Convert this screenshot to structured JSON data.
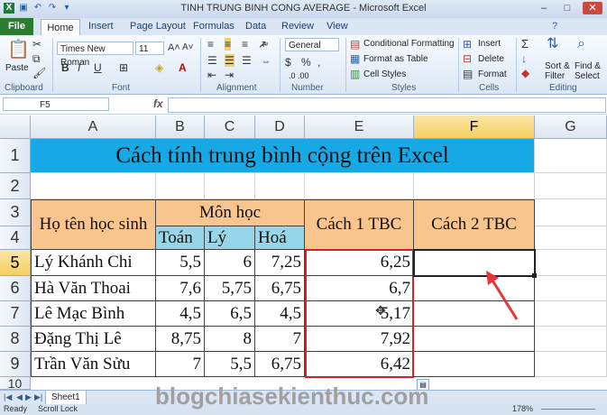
{
  "window": {
    "title": "TINH TRUNG BINH CONG AVERAGE - Microsoft Excel",
    "min": "–",
    "max": "□",
    "close": "✕",
    "help": "?"
  },
  "tabs": [
    "File",
    "Home",
    "Insert",
    "Page Layout",
    "Formulas",
    "Data",
    "Review",
    "View"
  ],
  "ribbon": {
    "paste": "Paste",
    "clipboard": "Clipboard",
    "font_name": "Times New Roman",
    "font_size": "11",
    "font_group": "Font",
    "bold": "B",
    "italic": "I",
    "underline": "U",
    "alignment": "Alignment",
    "number_format": "General",
    "number_group": "Number",
    "cond_format": "Conditional Formatting",
    "format_table": "Format as Table",
    "cell_styles": "Cell Styles",
    "styles_group": "Styles",
    "insert": "Insert",
    "delete": "Delete",
    "format": "Format",
    "cells_group": "Cells",
    "sort_filter_1": "Sort &",
    "sort_filter_2": "Filter",
    "find_select_1": "Find &",
    "find_select_2": "Select",
    "editing_group": "Editing",
    "sigma": "Σ",
    "dollar": "$",
    "percent": "%",
    "comma": ",",
    "decimals": ".0 .00"
  },
  "formula_bar": {
    "name_box": "F5",
    "fx": "fx",
    "formula": ""
  },
  "columns": [
    "A",
    "B",
    "C",
    "D",
    "E",
    "F",
    "G"
  ],
  "rows": [
    "1",
    "2",
    "3",
    "4",
    "5",
    "6",
    "7",
    "8",
    "9",
    "10"
  ],
  "sheet": {
    "title": "Cách tính trung bình cộng trên Excel",
    "header_name": "Họ tên học sinh",
    "header_subjects": "Môn học",
    "header_toan": "Toán",
    "header_ly": "Lý",
    "header_hoa": "Hoá",
    "header_tbc1": "Cách 1 TBC",
    "header_tbc2": "Cách 2 TBC",
    "students": [
      {
        "name": "Lý Khánh Chi",
        "toan": "5,5",
        "ly": "6",
        "hoa": "7,25",
        "tbc1": "6,25"
      },
      {
        "name": "Hà Văn Thoai",
        "toan": "7,6",
        "ly": "5,75",
        "hoa": "6,75",
        "tbc1": "6,7"
      },
      {
        "name": "Lê Mạc Bình",
        "toan": "4,5",
        "ly": "6,5",
        "hoa": "4,5",
        "tbc1": "5,17"
      },
      {
        "name": "Đặng Thị Lê",
        "toan": "8,75",
        "ly": "8",
        "hoa": "7",
        "tbc1": "7,92"
      },
      {
        "name": "Trần Văn Sửu",
        "toan": "7",
        "ly": "5,5",
        "hoa": "6,75",
        "tbc1": "6,42"
      }
    ]
  },
  "sheet_tab": "Sheet1",
  "status": {
    "ready": "Ready",
    "scroll_lock": "Scroll Lock",
    "zoom": "178%"
  },
  "watermark": "blogchiasekienthuc.com",
  "colors": {
    "title_fill": "#17a9e6",
    "header_fill": "#f9c58f",
    "subject_fill": "#96d6e8",
    "highlight_border": "#d9201f",
    "arrow": "#e8343b",
    "file_tab": "#2a7d2e"
  }
}
